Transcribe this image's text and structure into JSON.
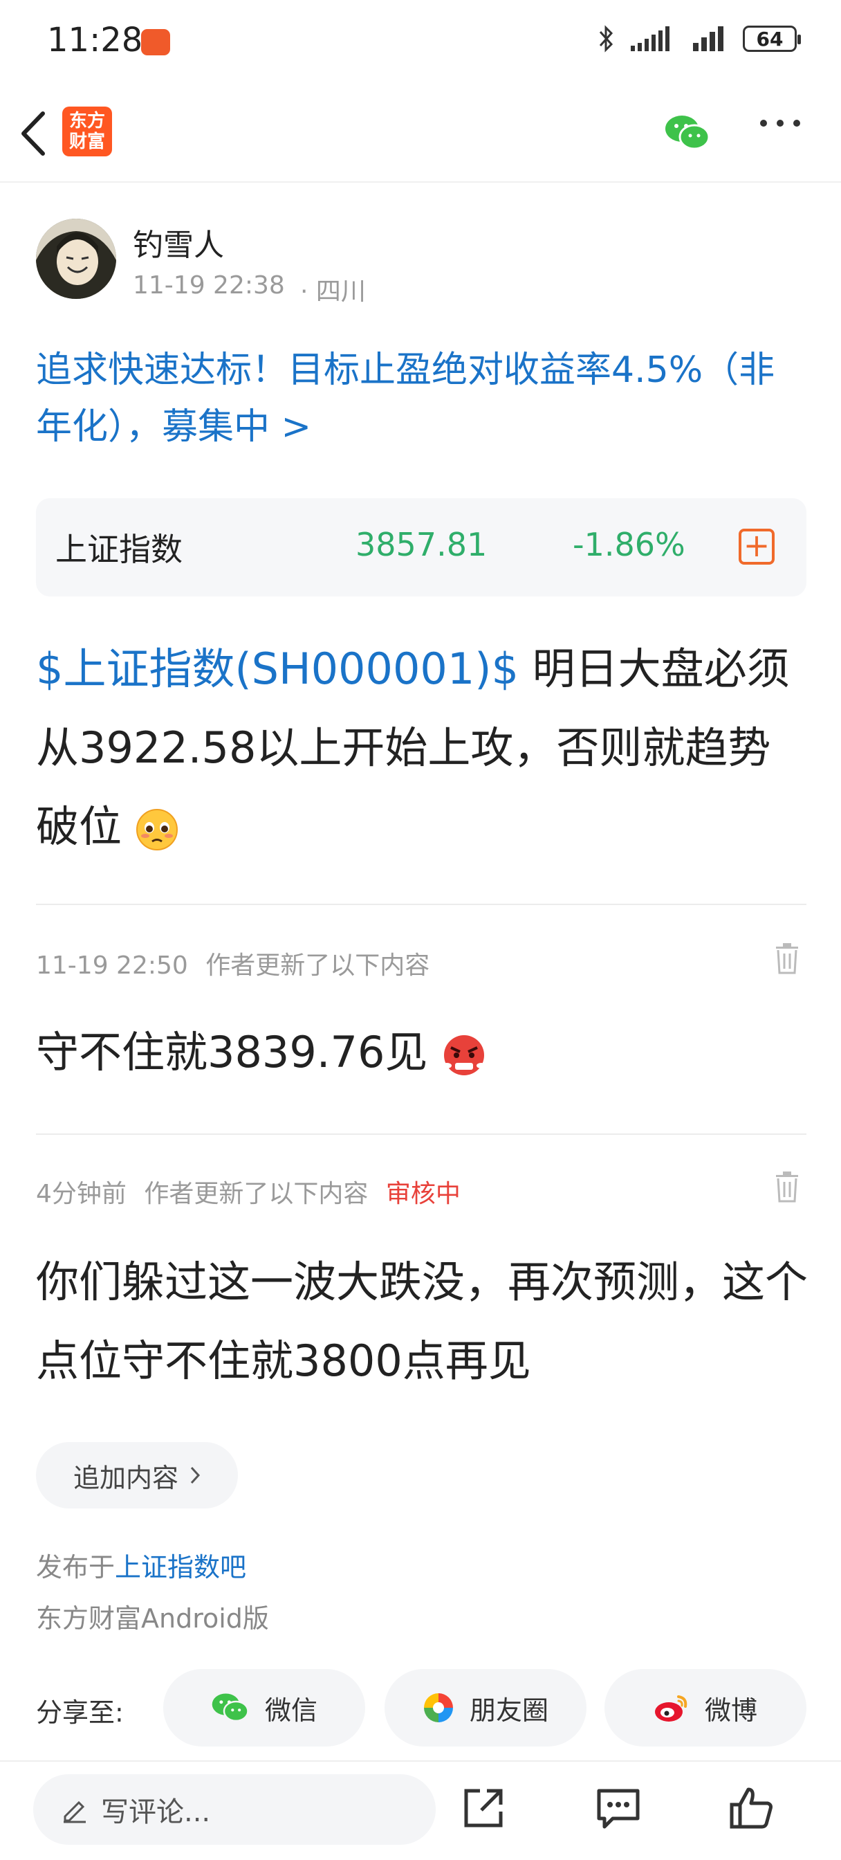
{
  "status_bar": {
    "time": "11:28",
    "battery": "64"
  },
  "nav": {
    "logo_line1": "东方",
    "logo_line2": "财富"
  },
  "author": {
    "name": "钓雪人",
    "time": "11-19 22:38",
    "location": "· 四川"
  },
  "promo": {
    "text": "追求快速达标！目标止盈绝对收益率4.5%（非年化），募集中 >"
  },
  "stock": {
    "name": "上证指数",
    "price": "3857.81",
    "change": "-1.86%"
  },
  "post": {
    "stock_link": "$上证指数(SH000001)$",
    "text": " 明日大盘必须从3922.58以上开始上攻，否则就趋势破位"
  },
  "updates": [
    {
      "time": "11-19 22:50",
      "label": "作者更新了以下内容",
      "status": "",
      "text": "守不住就3839.76见"
    },
    {
      "time": "4分钟前",
      "label": "作者更新了以下内容",
      "status": "审核中",
      "text": "你们躲过这一波大跌没，再次预测，这个点位守不住就3800点再见"
    }
  ],
  "append_button": "追加内容",
  "published": {
    "prefix": "发布于",
    "bar": "上证指数吧"
  },
  "client": "东方财富Android版",
  "share": {
    "label": "分享至:",
    "wechat": "微信",
    "moments": "朋友圈",
    "weibo": "微博"
  },
  "comment_placeholder": "写评论...",
  "colors": {
    "link": "#1a73c8",
    "down_green": "#2fae6a",
    "accent_orange": "#f06a2b",
    "review_red": "#e8413a"
  },
  "icons": [
    "back-icon",
    "wechat-icon",
    "more-icon",
    "add-stock-icon",
    "trash-icon",
    "chevron-right-icon",
    "moments-icon",
    "weibo-icon",
    "pencil-icon",
    "share-icon",
    "comment-icon",
    "like-icon"
  ]
}
